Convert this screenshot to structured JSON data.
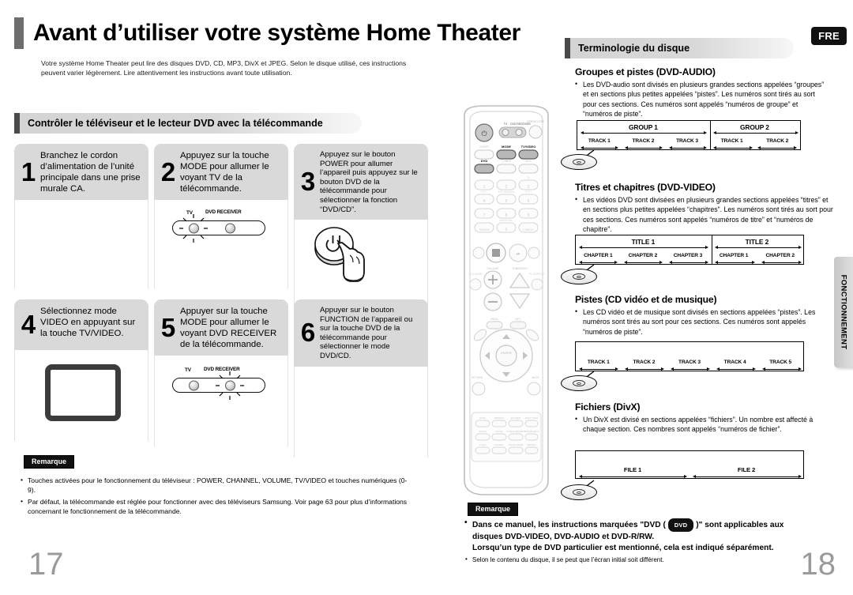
{
  "left_page": {
    "title": "Avant d’utiliser votre système Home Theater",
    "intro": "Votre système Home Theater peut lire des disques DVD, CD, MP3, DivX et JPEG. Selon le disque utilisé, ces instructions peuvent varier légèrement. Lire attentivement les instructions avant toute utilisation.",
    "section_title": "Contrôler le téléviseur et le lecteur DVD avec la télécommande",
    "page_number": "17",
    "steps": [
      {
        "num": "1",
        "text": "Branchez le cordon d’alimentation de l’unité principale dans une prise murale CA."
      },
      {
        "num": "2",
        "text": "Appuyez sur la touche MODE pour allumer le voyant TV de la télécommande."
      },
      {
        "num": "3",
        "text": "Appuyez sur le bouton POWER pour allumer l’appareil puis appuyez sur le bouton DVD de la télécommande pour sélectionner la fonction “DVD/CD”."
      },
      {
        "num": "4",
        "text": "Sélectionnez mode VIDEO en appuyant sur la touche TV/VIDEO."
      },
      {
        "num": "5",
        "text": "Appuyer sur la touche MODE pour allumer le voyant DVD RECEIVER de la télécommande."
      },
      {
        "num": "6",
        "text": "Appuyer sur le bouton FUNCTION de l’appareil ou sur la touche DVD de la télécommande pour sélectionner le mode DVD/CD."
      }
    ],
    "led_labels": {
      "tv": "TV",
      "dvd_receiver": "DVD RECEIVER"
    },
    "note": {
      "tag": "Remarque",
      "items": [
        "Touches activées pour le fonctionnement du téléviseur : POWER, CHANNEL, VOLUME, TV/VIDEO et touches numériques (0-9).",
        "Par défaut, la télécommande est réglée pour fonctionner avec des téléviseurs Samsung. Voir page 63 pour plus d’informations concernant le fonctionnement de la télécommande."
      ]
    }
  },
  "right_page": {
    "lang_badge": "FRE",
    "side_tab": "FONCTIONNEMENT",
    "section_title": "Terminologie du disque",
    "page_number": "18",
    "blocks": [
      {
        "heading": "Groupes et pistes (DVD-AUDIO)",
        "body": "Les DVD-audio sont divisés en plusieurs grandes sections appelées “groupes” et en sections plus petites appelées “pistes”. Les numéros sont tirés au sort pour ces sections. Ces numéros sont appelés “numéros de groupe” et “numéros de piste”.",
        "majors": [
          "GROUP 1",
          "GROUP 2"
        ],
        "minors_1": [
          "TRACK 1",
          "TRACK 2",
          "TRACK 3"
        ],
        "minors_2": [
          "TRACK 1",
          "TRACK 2"
        ]
      },
      {
        "heading": "Titres et chapitres (DVD-VIDEO)",
        "body": "Les vidéos DVD sont divisées en plusieurs grandes sections appelées “titres” et en sections plus petites appelées “chapitres”. Les numéros sont tirés au sort pour ces sections. Ces numéros sont appelés “numéros de titre” et “numéros de chapitre”.",
        "majors": [
          "TITLE 1",
          "TITLE 2"
        ],
        "minors_1": [
          "CHAPTER 1",
          "CHAPTER 2",
          "CHAPTER 3"
        ],
        "minors_2": [
          "CHAPTER 1",
          "CHAPTER 2"
        ]
      },
      {
        "heading": "Pistes (CD vidéo et de musique)",
        "body": "Les CD vidéo et de musique sont divisés en sections appelées “pistes”. Les numéros sont tirés au sort pour ces sections. Ces numéros sont appelés “numéros de piste”.",
        "tracks": [
          "TRACK 1",
          "TRACK 2",
          "TRACK 3",
          "TRACK 4",
          "TRACK 5"
        ]
      },
      {
        "heading": "Fichiers (DivX)",
        "body": "Un DivX est divisé en sections appelées “fichiers”. Un nombre est affecté à chaque section. Ces nombres sont appelés “numéros de fichier”.",
        "files": [
          "FILE 1",
          "FILE 2"
        ]
      }
    ],
    "note": {
      "tag": "Remarque",
      "line1_a": "Dans ce manuel, les instructions marquées \"DVD ( ",
      "pill": "DVD",
      "line1_b": " )\" sont applicables aux",
      "line2": "disques DVD-VIDEO, DVD-AUDIO et DVD-R/RW.",
      "line3": "Lorsqu’un type de DVD particulier est mentionné, cela est indiqué séparément.",
      "line4": "Selon le contenu du disque, il se peut que l’écran initial soit différent."
    }
  },
  "remote": {
    "labels": {
      "power": "POWER",
      "tv": "TV",
      "dvd_receiver": "DVD RECEIVER",
      "open_close": "OPEN/CLOSE",
      "sleep": "SLEEP",
      "mode": "MODE",
      "tv_video": "TV/VIDEO",
      "dvd": "DVD",
      "tuner": "TUNER",
      "aux": "AUX",
      "enter": "ENTER",
      "return": "RETURN",
      "mute": "MUTE",
      "volume": "VOLUME",
      "tuning": "TUNING/CH",
      "menu": "MENU",
      "info": "INFO"
    }
  },
  "colors": {
    "header_bar": "#4a4a4a",
    "step_box": "#d9d9d9",
    "badge_bg": "#111111",
    "page_number": "#9a9a9a",
    "side_tab": "#c7c7c7"
  }
}
